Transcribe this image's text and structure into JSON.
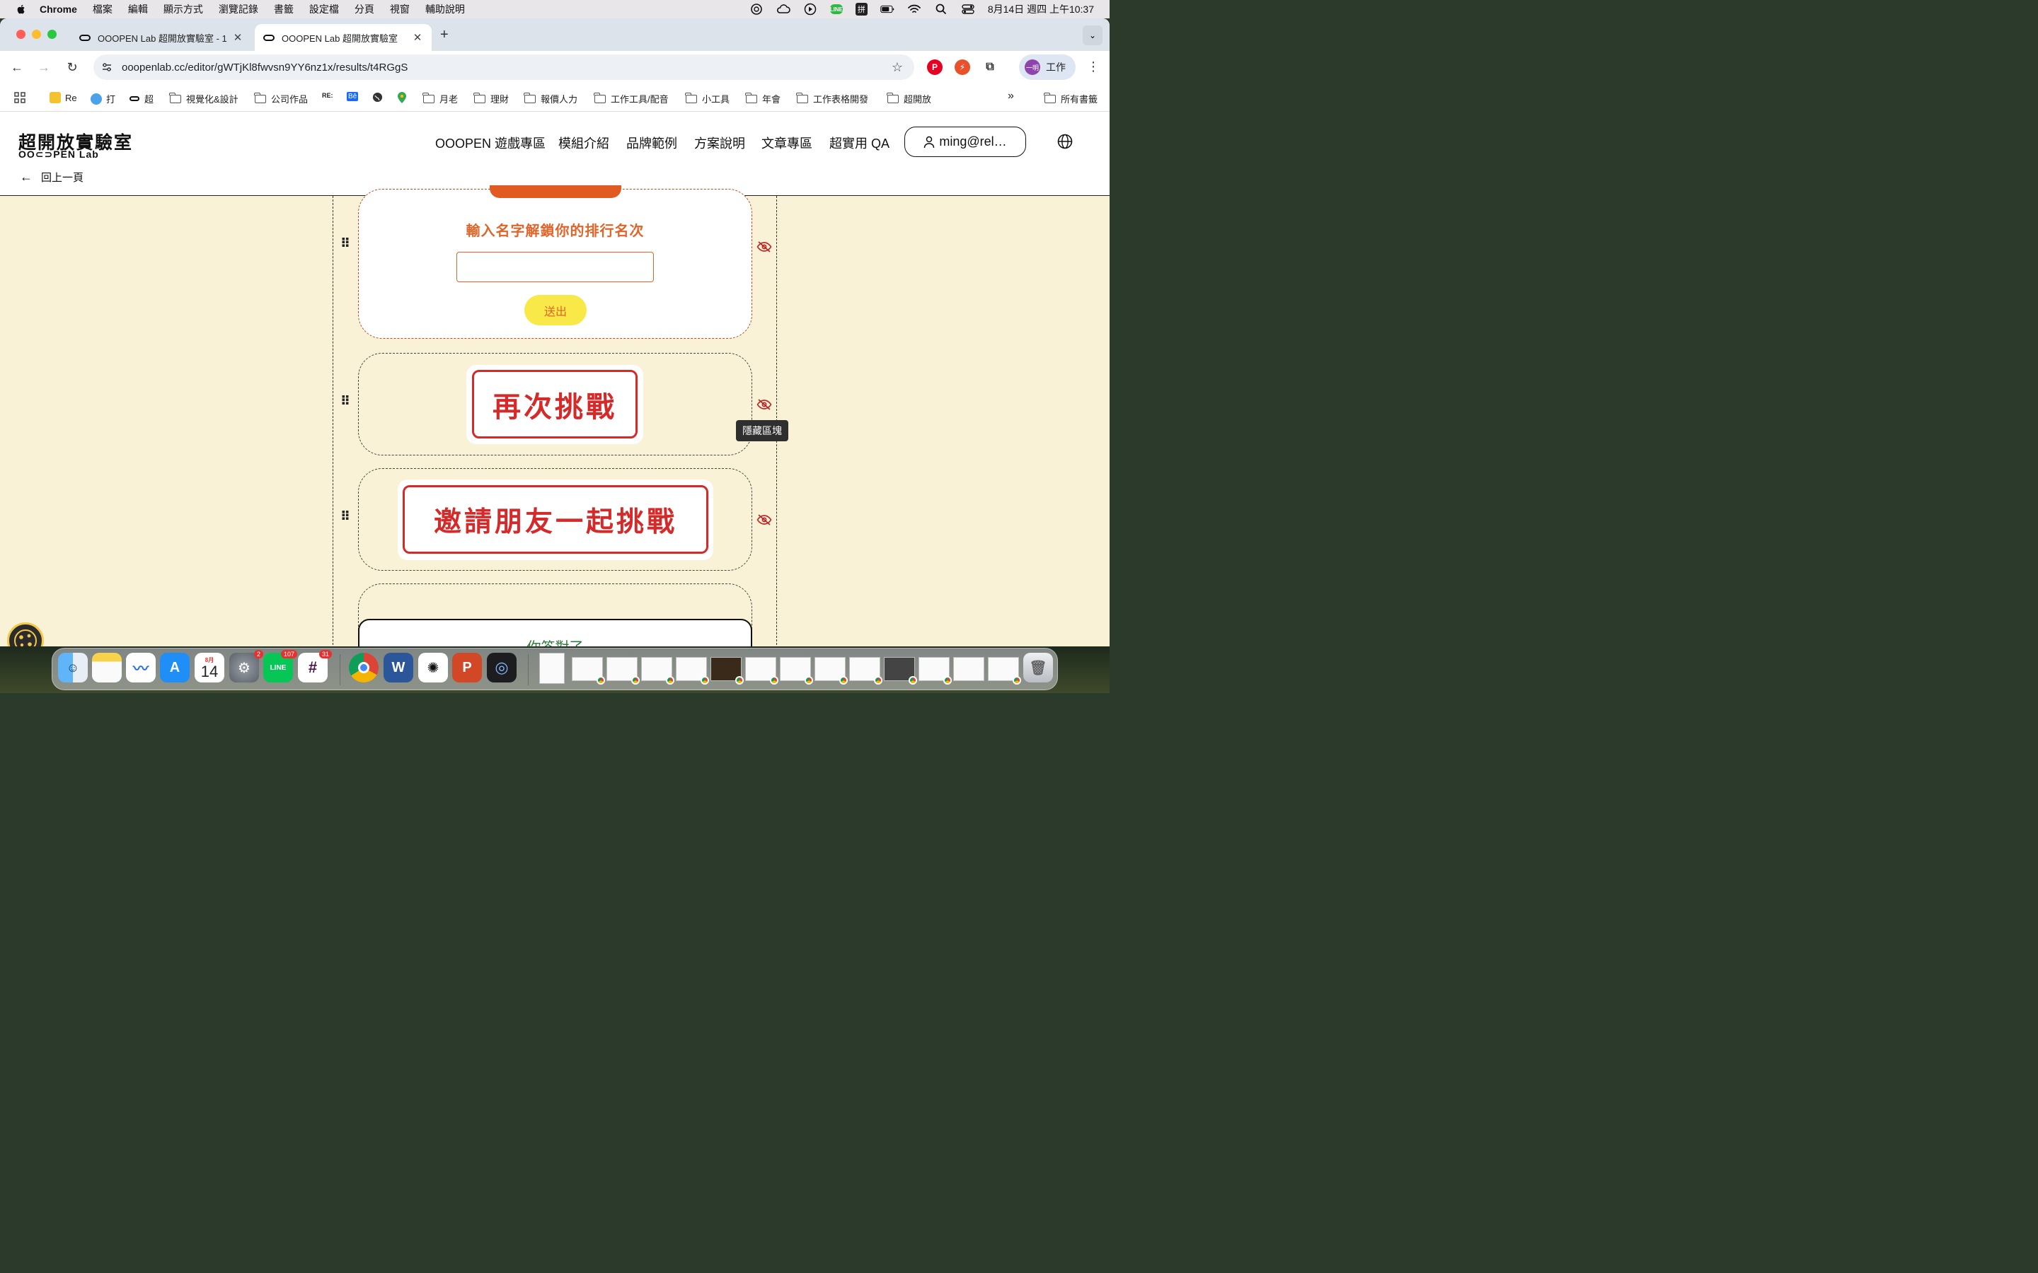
{
  "menubar": {
    "app": "Chrome",
    "items": [
      "檔案",
      "編輯",
      "顯示方式",
      "瀏覽記錄",
      "書籤",
      "設定檔",
      "分頁",
      "視窗",
      "輔助說明"
    ],
    "input_method": "拼",
    "line_label": "LINE",
    "datetime": "8月14日 週四 上午10:37"
  },
  "browser": {
    "tabs": [
      {
        "title": "OOOPEN Lab 超開放實驗室 - 1",
        "active": false
      },
      {
        "title": "OOOPEN Lab 超開放實驗室",
        "active": true
      }
    ],
    "new_tab": "+",
    "url": "ooopenlab.cc/editor/gWTjKl8fwvsn9YY6nz1x/results/t4RGgS",
    "profile_avatar": "一明",
    "profile_label": "工作",
    "bookmarks": [
      {
        "label": "Re",
        "kind": "yellow"
      },
      {
        "label": "打",
        "kind": "cloud"
      },
      {
        "label": "超",
        "kind": "ooopen"
      },
      {
        "label": "視覺化&設計",
        "kind": "folder"
      },
      {
        "label": "公司作品",
        "kind": "folder"
      },
      {
        "label": "RE:",
        "kind": "text"
      },
      {
        "label": "Bē",
        "kind": "behance"
      },
      {
        "label": "",
        "kind": "globe"
      },
      {
        "label": "",
        "kind": "maps"
      },
      {
        "label": "月老",
        "kind": "folder"
      },
      {
        "label": "理財",
        "kind": "folder"
      },
      {
        "label": "報價人力",
        "kind": "folder"
      },
      {
        "label": "工作工具/配音",
        "kind": "folder"
      },
      {
        "label": "小工具",
        "kind": "folder"
      },
      {
        "label": "年會",
        "kind": "folder"
      },
      {
        "label": "工作表格開發",
        "kind": "folder"
      },
      {
        "label": "超開放",
        "kind": "folder"
      }
    ],
    "bookmarks_more": "»",
    "all_bookmarks": "所有書籤"
  },
  "site": {
    "logo_cn": "超開放實驗室",
    "logo_en": "OO⊂⊃PEN Lab",
    "nav": [
      "OOOPEN 遊戲專區",
      "模組介紹",
      "品牌範例",
      "方案說明",
      "文章專區",
      "超實用 QA"
    ],
    "user_email": "ming@rel…",
    "back_label": "回上一頁"
  },
  "editor": {
    "form_prompt": "輸入名字解鎖你的排行名次",
    "name_input_value": "",
    "submit_label": "送出",
    "retry_button": "再次挑戰",
    "invite_button": "邀請朋友一起挑戰",
    "tooltip": "隱藏區塊",
    "answer_text": "你答對了"
  },
  "dock": {
    "apps": [
      {
        "name": "Finder"
      },
      {
        "name": "Notes"
      },
      {
        "name": "Freeform"
      },
      {
        "name": "App Store"
      },
      {
        "name": "Calendar",
        "month": "8月",
        "day": "14"
      },
      {
        "name": "System Settings",
        "badge": "2"
      },
      {
        "name": "LINE",
        "badge": "107",
        "label": "LINE"
      },
      {
        "name": "Slack",
        "badge": "31"
      },
      {
        "name": "Chrome"
      },
      {
        "name": "Word",
        "label": "W"
      },
      {
        "name": "ChatGPT"
      },
      {
        "name": "PowerPoint",
        "label": "P"
      },
      {
        "name": "QuickTime"
      }
    ]
  },
  "colors": {
    "page_bg": "#faf2d6",
    "accent_orange": "#e0652a",
    "accent_red": "#d42a2a",
    "submit_yellow": "#f8e948",
    "answer_green": "#2b7a3a"
  }
}
